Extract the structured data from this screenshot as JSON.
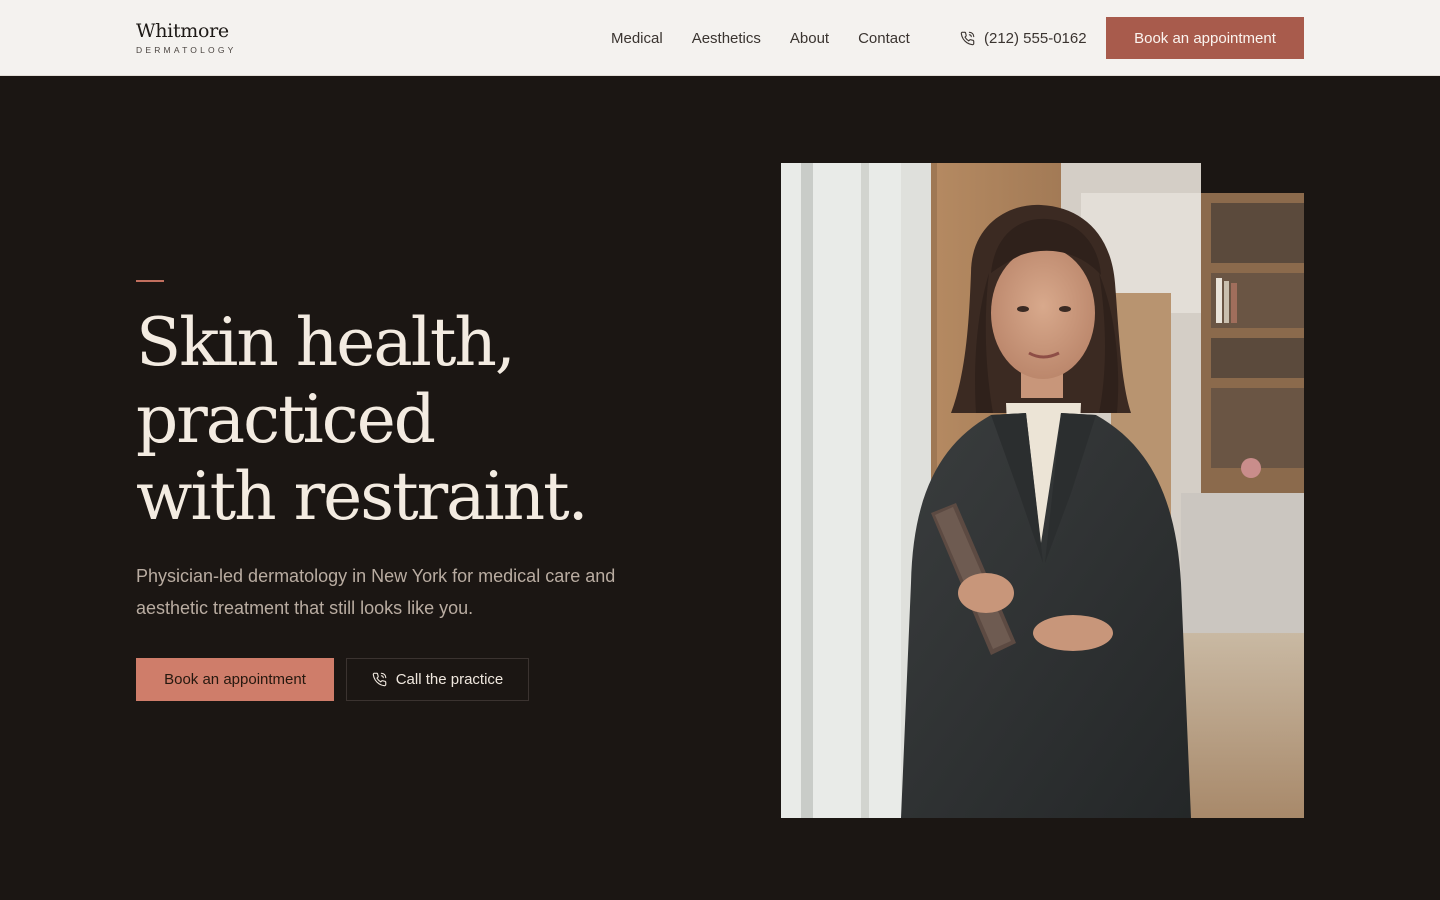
{
  "brand": {
    "name": "Whitmore",
    "subtitle": "DERMATOLOGY"
  },
  "nav": {
    "items": [
      "Medical",
      "Aesthetics",
      "About",
      "Contact"
    ]
  },
  "header": {
    "phone": "(212) 555-0162",
    "cta_label": "Book an appointment"
  },
  "hero": {
    "headline_lines": [
      "Skin health,",
      "practiced",
      "with restraint."
    ],
    "subcopy": "Physician-led dermatology in New York for medical care and aesthetic treatment that still looks like you.",
    "primary_cta": "Book an appointment",
    "secondary_cta": "Call the practice"
  },
  "colors": {
    "header_bg": "#f4f2ef",
    "hero_bg": "#1b1613",
    "accent": "#a85b4c",
    "accent_light": "#cf7d6a",
    "headline": "#f3ebe1"
  },
  "icons": {
    "phone": "phone-call-icon"
  }
}
